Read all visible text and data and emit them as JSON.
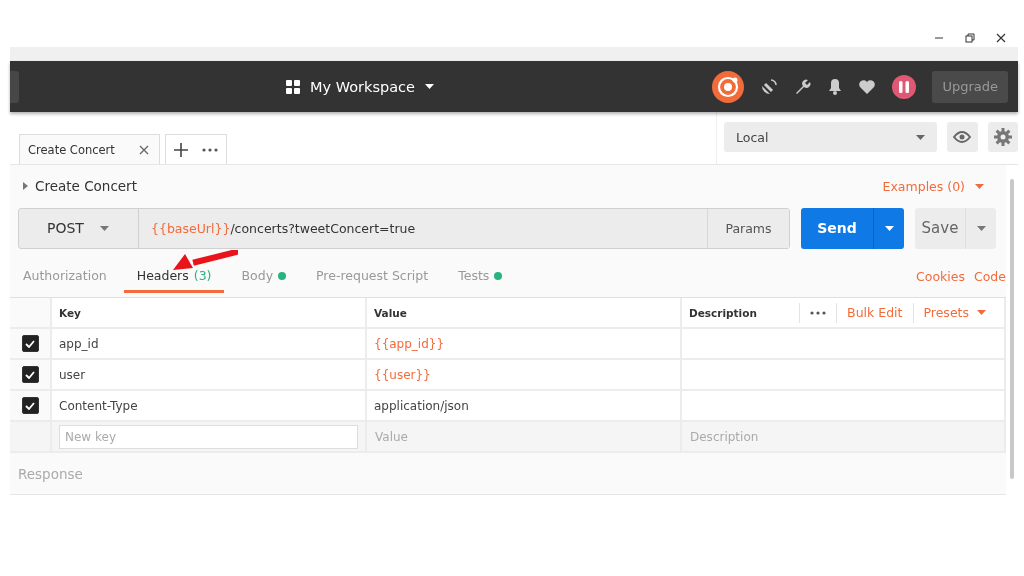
{
  "header": {
    "workspace": "My Workspace",
    "upgrade_button": "Upgrade"
  },
  "tabs": [
    {
      "label": "Create Concert",
      "selected": true
    }
  ],
  "environment": {
    "value": "Local"
  },
  "request": {
    "name": "Create Concert",
    "examples": "Examples (0)",
    "method": "POST",
    "url_variable": "{{baseUrl}}",
    "url_path": "/concerts?tweetConcert=true",
    "params_button": "Params",
    "send_button": "Send",
    "save_button": "Save"
  },
  "request_tabs": [
    {
      "label": "Authorization",
      "selected": false,
      "has_content": false
    },
    {
      "label": "Headers",
      "count": "(3)",
      "selected": true,
      "has_content": false
    },
    {
      "label": "Body",
      "selected": false,
      "has_content": true
    },
    {
      "label": "Pre-request Script",
      "selected": false,
      "has_content": false
    },
    {
      "label": "Tests",
      "selected": false,
      "has_content": true
    }
  ],
  "links": [
    "Cookies",
    "Code"
  ],
  "headers_table": {
    "columns": [
      "Key",
      "Value",
      "Description"
    ],
    "actions": [
      "Bulk Edit",
      "Presets"
    ],
    "rows": [
      {
        "checked": true,
        "key": "app_id",
        "value": "{{app_id}}",
        "color": "#f26b3a"
      },
      {
        "checked": true,
        "key": "user",
        "value": "{{user}}",
        "color": "#f26b3a"
      },
      {
        "checked": true,
        "key": "Content-Type",
        "value": "application/json",
        "color": "#444444"
      }
    ],
    "new_row": {
      "key_placeholder": "New key",
      "value_placeholder": "Value",
      "description_placeholder": "Description"
    }
  },
  "response": {
    "label": "Response"
  }
}
